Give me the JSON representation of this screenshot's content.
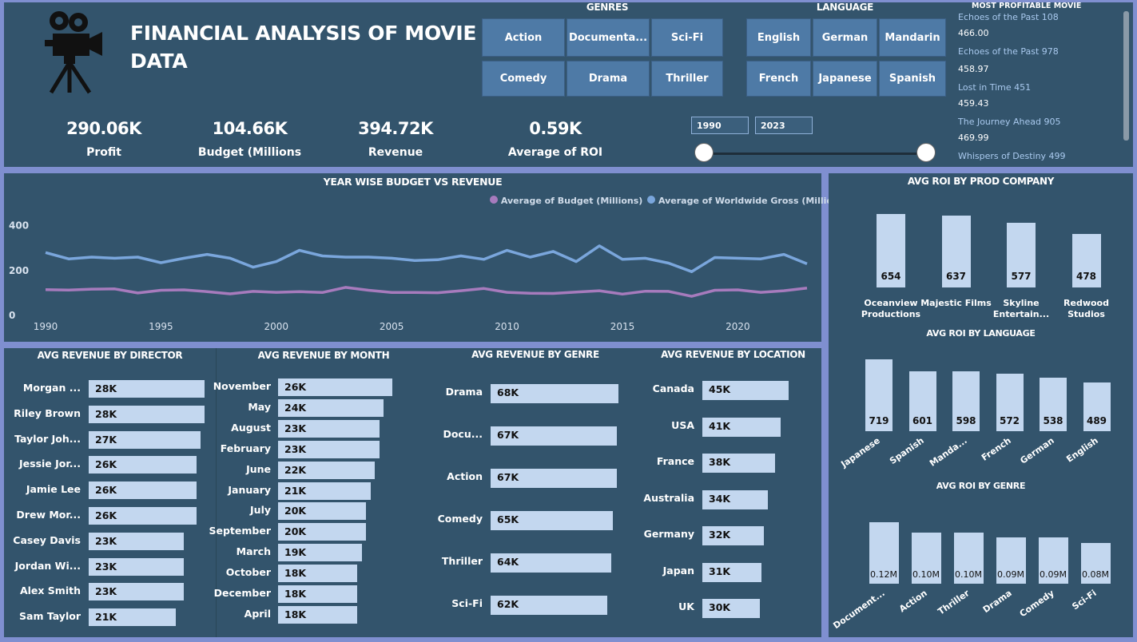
{
  "header": {
    "title_line1": "FINANCIAL ANALYSIS OF MOVIE",
    "title_line2": "DATA"
  },
  "kpis": [
    {
      "value": "290.06K",
      "label": "Profit"
    },
    {
      "value": "104.66K",
      "label": "Budget (Millions"
    },
    {
      "value": "394.72K",
      "label": "Revenue"
    },
    {
      "value": "0.59K",
      "label": "Average of ROI"
    }
  ],
  "genres_slicer": {
    "title": "GENRES",
    "items": [
      "Action",
      "Documenta...",
      "Sci-Fi",
      "Comedy",
      "Drama",
      "Thriller"
    ]
  },
  "language_slicer": {
    "title": "LANGUAGE",
    "items": [
      "English",
      "German",
      "Mandarin",
      "French",
      "Japanese",
      "Spanish"
    ]
  },
  "year_slider": {
    "start": "1990",
    "end": "2023"
  },
  "most_profitable": {
    "title": "MOST PROFITABLE MOVIE",
    "items": [
      {
        "name": "Echoes of the Past 108",
        "value": "466.00"
      },
      {
        "name": "Echoes of the Past 978",
        "value": "458.97"
      },
      {
        "name": "Lost in Time 451",
        "value": "459.43"
      },
      {
        "name": "The Journey Ahead 905",
        "value": "469.99"
      },
      {
        "name": "Whispers of Destiny 499",
        "value": ""
      }
    ]
  },
  "colors": {
    "background": "#33546c",
    "border": "#7f8fd0",
    "bar": "#c3d7ef",
    "budget_line": "#a77bbd",
    "gross_line": "#7aa6dc",
    "slicer": "#4e7aa6"
  },
  "icons": [
    "movie-camera-icon"
  ],
  "chart_data": [
    {
      "type": "line",
      "title": "YEAR WISE BUDGET VS REVENUE",
      "x": [
        1990,
        1991,
        1992,
        1993,
        1994,
        1995,
        1996,
        1997,
        1998,
        1999,
        2000,
        2001,
        2002,
        2003,
        2004,
        2005,
        2006,
        2007,
        2008,
        2009,
        2010,
        2011,
        2012,
        2013,
        2014,
        2015,
        2016,
        2017,
        2018,
        2019,
        2020,
        2021,
        2022,
        2023
      ],
      "x_ticks": [
        "1990",
        "1995",
        "2000",
        "2005",
        "2010",
        "2015",
        "2020"
      ],
      "y_ticks": [
        "0",
        "200",
        "400"
      ],
      "ylim": [
        0,
        420
      ],
      "series": [
        {
          "name": "Average of Budget (Millions)",
          "values": [
            115,
            113,
            117,
            118,
            100,
            112,
            114,
            106,
            96,
            107,
            103,
            106,
            102,
            125,
            112,
            102,
            102,
            101,
            110,
            120,
            103,
            99,
            98,
            104,
            110,
            95,
            108,
            107,
            85,
            112,
            114,
            103,
            110,
            122
          ]
        },
        {
          "name": "Average of Worldwide Gross (Millions)",
          "values": [
            280,
            252,
            260,
            255,
            260,
            235,
            255,
            272,
            255,
            215,
            240,
            290,
            265,
            260,
            260,
            255,
            245,
            248,
            265,
            250,
            290,
            260,
            285,
            240,
            310,
            250,
            255,
            233,
            195,
            258,
            255,
            252,
            272,
            230
          ]
        }
      ]
    },
    {
      "type": "bar",
      "title": "AVG REVENUE BY DIRECTOR",
      "categories": [
        "Morgan ...",
        "Riley Brown",
        "Taylor Joh...",
        "Jessie Jor...",
        "Jamie Lee",
        "Drew Mor...",
        "Casey Davis",
        "Jordan Wi...",
        "Alex Smith",
        "Sam Taylor"
      ],
      "values": [
        28,
        28,
        27,
        26,
        26,
        26,
        23,
        23,
        23,
        21
      ],
      "labels": [
        "28K",
        "28K",
        "27K",
        "26K",
        "26K",
        "26K",
        "23K",
        "23K",
        "23K",
        "21K"
      ]
    },
    {
      "type": "bar",
      "title": "AVG REVENUE BY MONTH",
      "categories": [
        "November",
        "May",
        "August",
        "February",
        "June",
        "January",
        "July",
        "September",
        "March",
        "October",
        "December",
        "April"
      ],
      "values": [
        26,
        24,
        23,
        23,
        22,
        21,
        20,
        20,
        19,
        18,
        18,
        18
      ],
      "labels": [
        "26K",
        "24K",
        "23K",
        "23K",
        "22K",
        "21K",
        "20K",
        "20K",
        "19K",
        "18K",
        "18K",
        "18K"
      ]
    },
    {
      "type": "bar",
      "title": "AVG REVENUE BY GENRE",
      "categories": [
        "Drama",
        "Docu...",
        "Action",
        "Comedy",
        "Thriller",
        "Sci-Fi"
      ],
      "values": [
        68,
        67,
        67,
        65,
        64,
        62
      ],
      "labels": [
        "68K",
        "67K",
        "67K",
        "65K",
        "64K",
        "62K"
      ]
    },
    {
      "type": "bar",
      "title": "AVG REVENUE BY LOCATION",
      "categories": [
        "Canada",
        "USA",
        "France",
        "Australia",
        "Germany",
        "Japan",
        "UK"
      ],
      "values": [
        45,
        41,
        38,
        34,
        32,
        31,
        30
      ],
      "labels": [
        "45K",
        "41K",
        "38K",
        "34K",
        "32K",
        "31K",
        "30K"
      ]
    },
    {
      "type": "bar",
      "title": "AVG ROI BY PROD COMPANY",
      "categories": [
        "Oceanview Productions",
        "Majestic Films",
        "Skyline Entertain...",
        "Redwood Studios"
      ],
      "values": [
        654,
        637,
        577,
        478
      ],
      "labels": [
        "654",
        "637",
        "577",
        "478"
      ]
    },
    {
      "type": "bar",
      "title": "AVG ROI BY LANGUAGE",
      "categories": [
        "Japanese",
        "Spanish",
        "Manda...",
        "French",
        "German",
        "English"
      ],
      "values": [
        719,
        601,
        598,
        572,
        538,
        489
      ],
      "labels": [
        "719",
        "601",
        "598",
        "572",
        "538",
        "489"
      ]
    },
    {
      "type": "bar",
      "title": "AVG ROI BY GENRE",
      "categories": [
        "Document...",
        "Action",
        "Thriller",
        "Drama",
        "Comedy",
        "Sci-Fi"
      ],
      "values": [
        0.12,
        0.1,
        0.1,
        0.09,
        0.09,
        0.08
      ],
      "labels": [
        "0.12M",
        "0.10M",
        "0.10M",
        "0.09M",
        "0.09M",
        "0.08M"
      ]
    }
  ]
}
